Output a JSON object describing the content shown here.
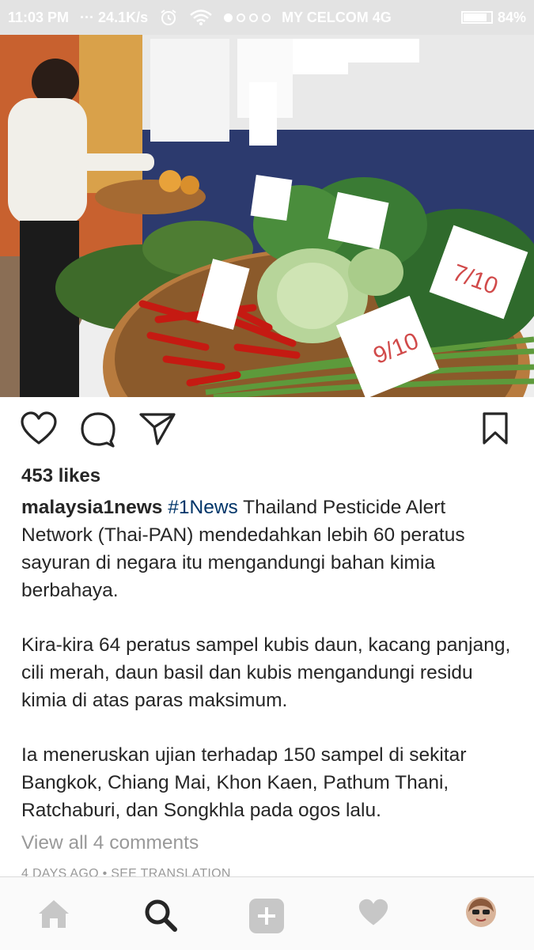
{
  "status_bar": {
    "time": "11:03 PM",
    "speed": "24.1K/s",
    "carrier": "MY CELCOM 4G",
    "battery": "84%",
    "battery_level": 0.84,
    "signal_bars": 1
  },
  "post": {
    "image_icon": "vegetable-market-photo",
    "likes": "453 likes",
    "username": "malaysia1news",
    "hashtag": "#1News",
    "caption_p1": " Thailand Pesticide Alert Network (Thai-PAN) mendedahkan lebih 60 peratus sayuran di negara itu mengandungi bahan kimia berbahaya.",
    "caption_p2": "Kira-kira 64 peratus sampel kubis daun, kacang panjang, cili merah, daun basil dan kubis mengandungi residu kimia di atas paras maksimum.",
    "caption_p3": "Ia meneruskan ujian terhadap 150 sampel di sekitar Bangkok, Chiang Mai, Khon Kaen, Pathum Thani, Ratchaburi, dan Songkhla pada ogos lalu.",
    "view_comments": "View all 4 comments",
    "timestamp": "4 DAYS AGO • SEE TRANSLATION",
    "price_tags": [
      "9/10",
      "7/10"
    ]
  },
  "actions": [
    "heart-icon",
    "comment-icon",
    "share-icon",
    "bookmark-icon"
  ],
  "bottom_nav": [
    "home-icon",
    "search-icon",
    "add-post-icon",
    "activity-heart-icon",
    "profile-avatar"
  ]
}
